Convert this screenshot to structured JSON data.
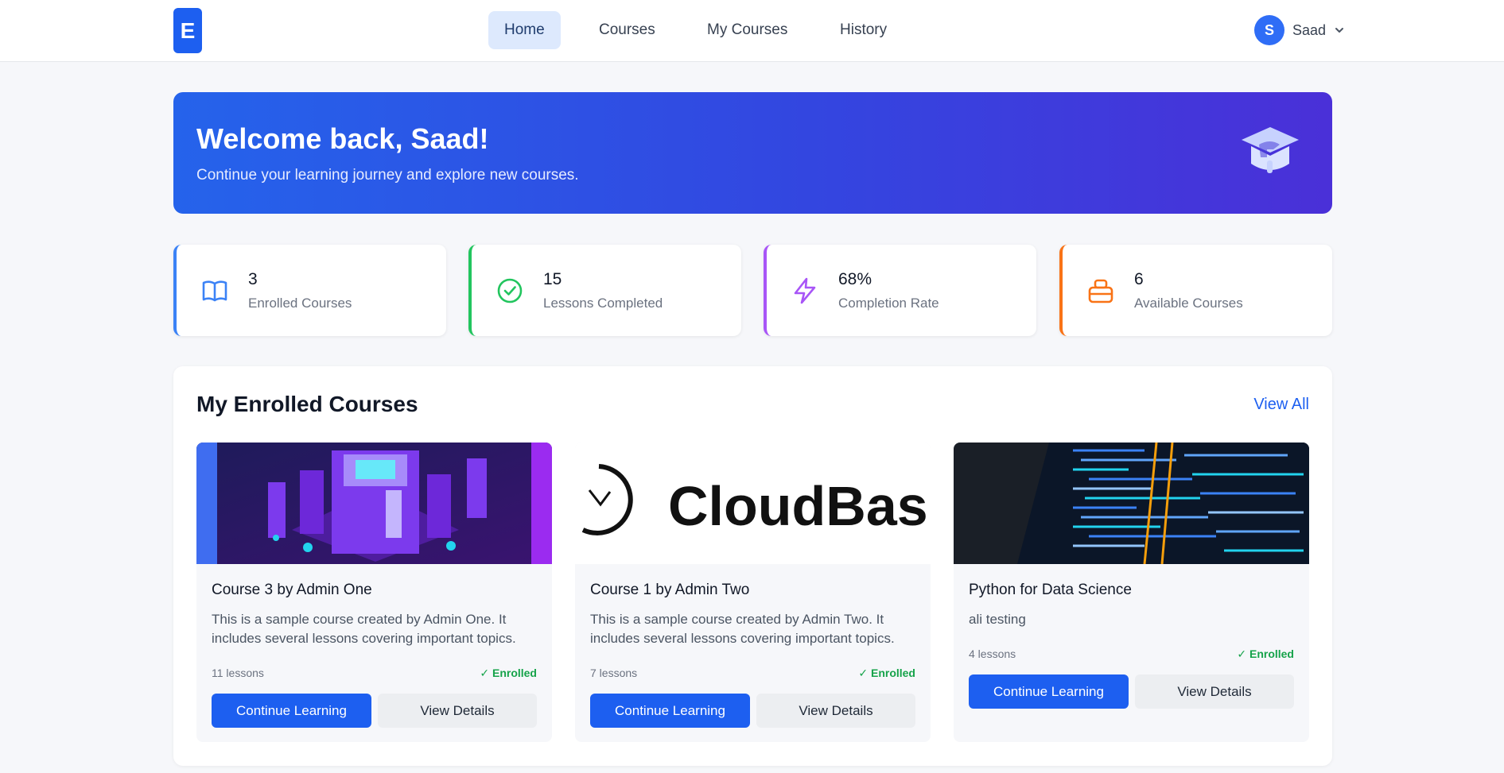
{
  "logo": {
    "letter": "E"
  },
  "nav": {
    "home": "Home",
    "courses": "Courses",
    "my_courses": "My Courses",
    "history": "History"
  },
  "user": {
    "initial": "S",
    "name": "Saad"
  },
  "hero": {
    "title": "Welcome back, Saad!",
    "subtitle": "Continue your learning journey and explore new courses."
  },
  "stats": [
    {
      "value": "3",
      "label": "Enrolled Courses",
      "icon": "book-open-icon",
      "color": "#3b82f6"
    },
    {
      "value": "15",
      "label": "Lessons Completed",
      "icon": "check-circle-icon",
      "color": "#22c55e"
    },
    {
      "value": "68%",
      "label": "Completion Rate",
      "icon": "lightning-icon",
      "color": "#a855f7"
    },
    {
      "value": "6",
      "label": "Available Courses",
      "icon": "briefcase-icon",
      "color": "#f97316"
    }
  ],
  "section": {
    "title": "My Enrolled Courses",
    "view_all": "View All"
  },
  "courses": [
    {
      "title": "Course 3 by Admin One",
      "description": "This is a sample course created by Admin One. It includes several lessons covering important topics.",
      "lessons": "11 lessons",
      "status": "✓ Enrolled",
      "primary": "Continue Learning",
      "secondary": "View Details"
    },
    {
      "title": "Course 1 by Admin Two",
      "description": "This is a sample course created by Admin Two. It includes several lessons covering important topics.",
      "lessons": "7 lessons",
      "status": "✓ Enrolled",
      "primary": "Continue Learning",
      "secondary": "View Details",
      "thumb_text": "CloudBas"
    },
    {
      "title": "Python for Data Science",
      "description": "ali testing",
      "lessons": "4 lessons",
      "status": "✓ Enrolled",
      "primary": "Continue Learning",
      "secondary": "View Details"
    }
  ]
}
